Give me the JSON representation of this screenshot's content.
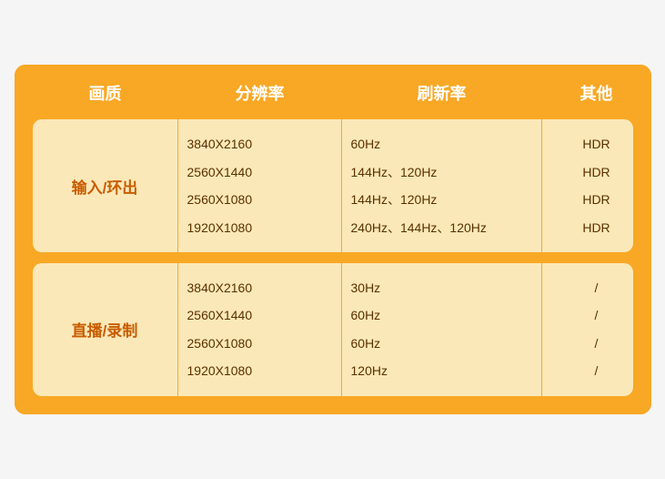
{
  "table": {
    "header": {
      "quality_label": "画质",
      "resolution_label": "分辨率",
      "refresh_label": "刷新率",
      "other_label": "其他"
    },
    "rows": [
      {
        "label": "输入/环出",
        "resolutions": [
          "3840X2160",
          "2560X1440",
          "2560X1080",
          "1920X1080"
        ],
        "refresh_rates": [
          "60Hz",
          "144Hz、120Hz",
          "144Hz、120Hz",
          "240Hz、144Hz、120Hz"
        ],
        "other": [
          "HDR",
          "HDR",
          "HDR",
          "HDR"
        ]
      },
      {
        "label": "直播/录制",
        "resolutions": [
          "3840X2160",
          "2560X1440",
          "2560X1080",
          "1920X1080"
        ],
        "refresh_rates": [
          "30Hz",
          "60Hz",
          "60Hz",
          "120Hz"
        ],
        "other": [
          "/",
          "/",
          "/",
          "/"
        ]
      }
    ]
  }
}
